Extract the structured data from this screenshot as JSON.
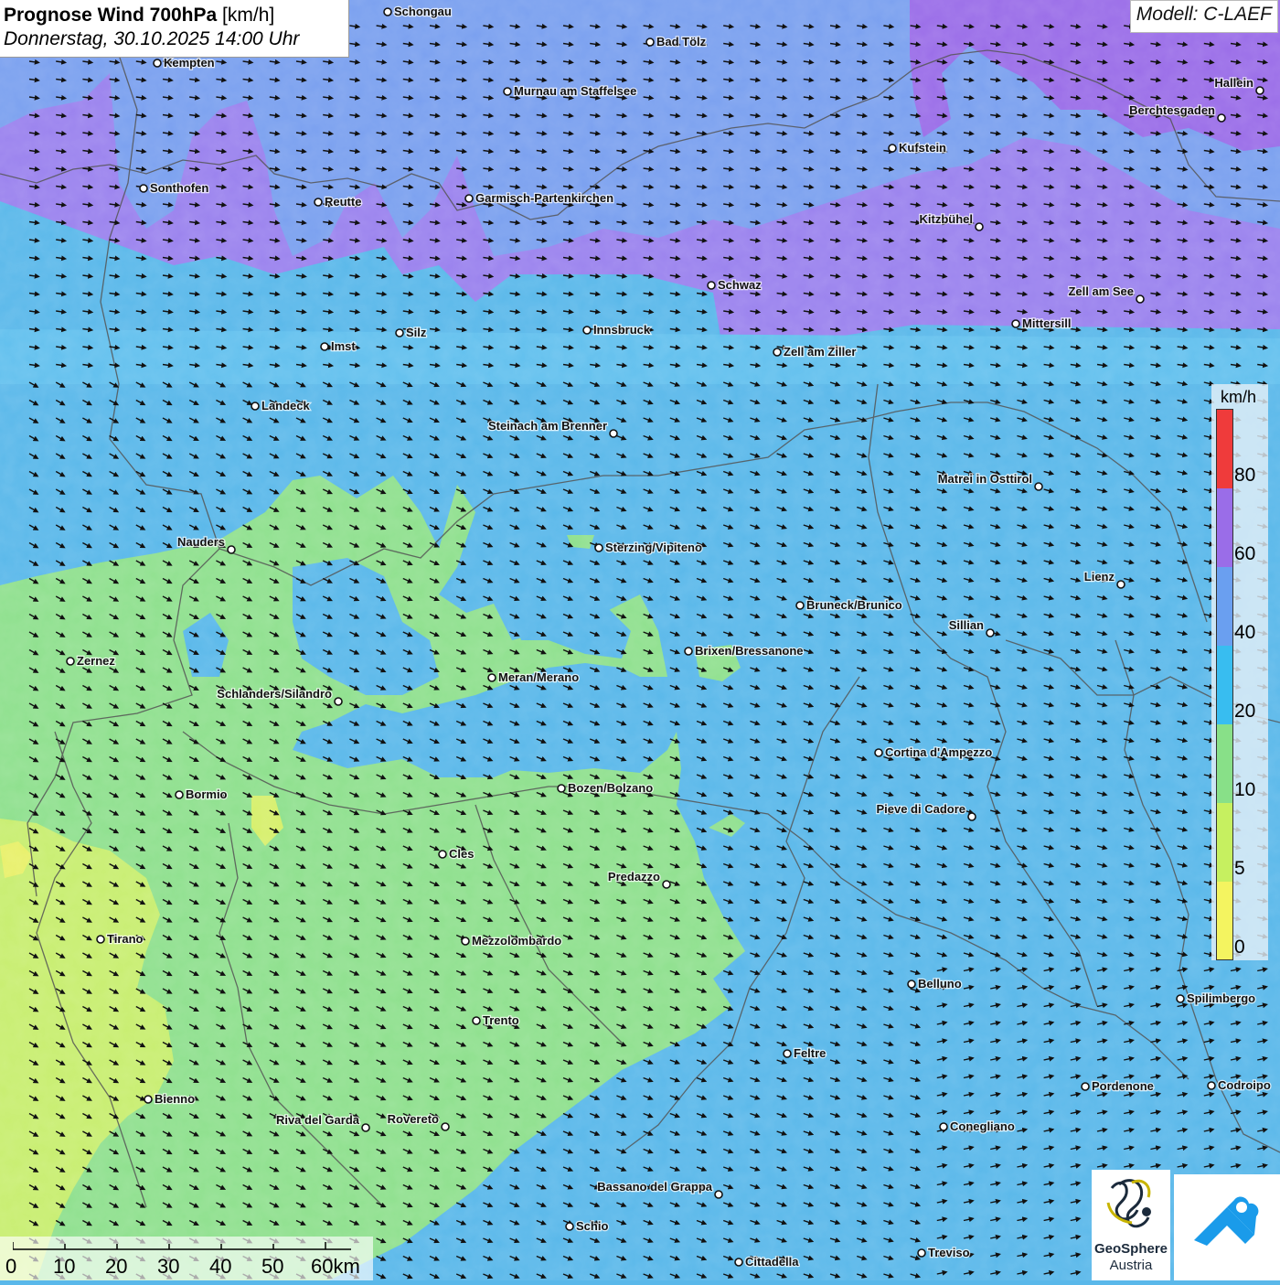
{
  "title": {
    "main": "Prognose Wind 700hPa",
    "unit": "[km/h]",
    "datetime": "Donnerstag, 30.10.2025 14:00 Uhr"
  },
  "model": "Modell: C-LAEF",
  "legend": {
    "unit": "km/h",
    "ticks": [
      "80",
      "60",
      "40",
      "20",
      "10",
      "5",
      "0"
    ],
    "colors": [
      "#ef3b3b",
      "#9a6de8",
      "#6a9ff0",
      "#38bdf0",
      "#88e088",
      "#c6f060",
      "#f4f460",
      "#f2f26a"
    ]
  },
  "scale": {
    "labels": [
      "0",
      "10",
      "20",
      "30",
      "40",
      "50",
      "60km"
    ]
  },
  "logo": {
    "line1": "GeoSphere",
    "line2": "Austria"
  },
  "colors": {
    "violet": "#8a78ee",
    "blue": "#7aa0ef",
    "cyan": "#5ab8ea",
    "green": "#8fe08e",
    "yellowgreen": "#c8ee70",
    "border": "#555555"
  },
  "cities": [
    {
      "name": "Schongau"
    },
    {
      "name": "Bad Tölz"
    },
    {
      "name": "Kempten"
    },
    {
      "name": "Murnau am Staffelsee"
    },
    {
      "name": "Hallein"
    },
    {
      "name": "Berchtesgaden"
    },
    {
      "name": "Kufstein"
    },
    {
      "name": "Sonthofen"
    },
    {
      "name": "Reutte"
    },
    {
      "name": "Garmisch-Partenkirchen"
    },
    {
      "name": "Kitzbühel"
    },
    {
      "name": "Schwaz"
    },
    {
      "name": "Zell am See"
    },
    {
      "name": "Mittersill"
    },
    {
      "name": "Silz"
    },
    {
      "name": "Innsbruck"
    },
    {
      "name": "Imst"
    },
    {
      "name": "Zell am Ziller"
    },
    {
      "name": "Landeck"
    },
    {
      "name": "Steinach am Brenner"
    },
    {
      "name": "Matrei in Osttirol"
    },
    {
      "name": "Nauders"
    },
    {
      "name": "Sterzing/Vipiteno"
    },
    {
      "name": "Lienz"
    },
    {
      "name": "Bruneck/Brunico"
    },
    {
      "name": "Sillian"
    },
    {
      "name": "Brixen/Bressanone"
    },
    {
      "name": "Zernez"
    },
    {
      "name": "Meran/Merano"
    },
    {
      "name": "Schlanders/Silandro"
    },
    {
      "name": "Cortina d'Ampezzo"
    },
    {
      "name": "Bozen/Bolzano"
    },
    {
      "name": "Bormio"
    },
    {
      "name": "Pieve di Cadore"
    },
    {
      "name": "Cles"
    },
    {
      "name": "Predazzo"
    },
    {
      "name": "Tirano"
    },
    {
      "name": "Mezzolombardo"
    },
    {
      "name": "Belluno"
    },
    {
      "name": "Spilimbergo"
    },
    {
      "name": "Trento"
    },
    {
      "name": "Feltre"
    },
    {
      "name": "Pordenone"
    },
    {
      "name": "Codroipo"
    },
    {
      "name": "Bienno"
    },
    {
      "name": "Riva del Garda"
    },
    {
      "name": "Rovereto"
    },
    {
      "name": "Conegliano"
    },
    {
      "name": "Bassano del Grappa"
    },
    {
      "name": "Schio"
    },
    {
      "name": "Treviso"
    },
    {
      "name": "Cittadella"
    }
  ]
}
